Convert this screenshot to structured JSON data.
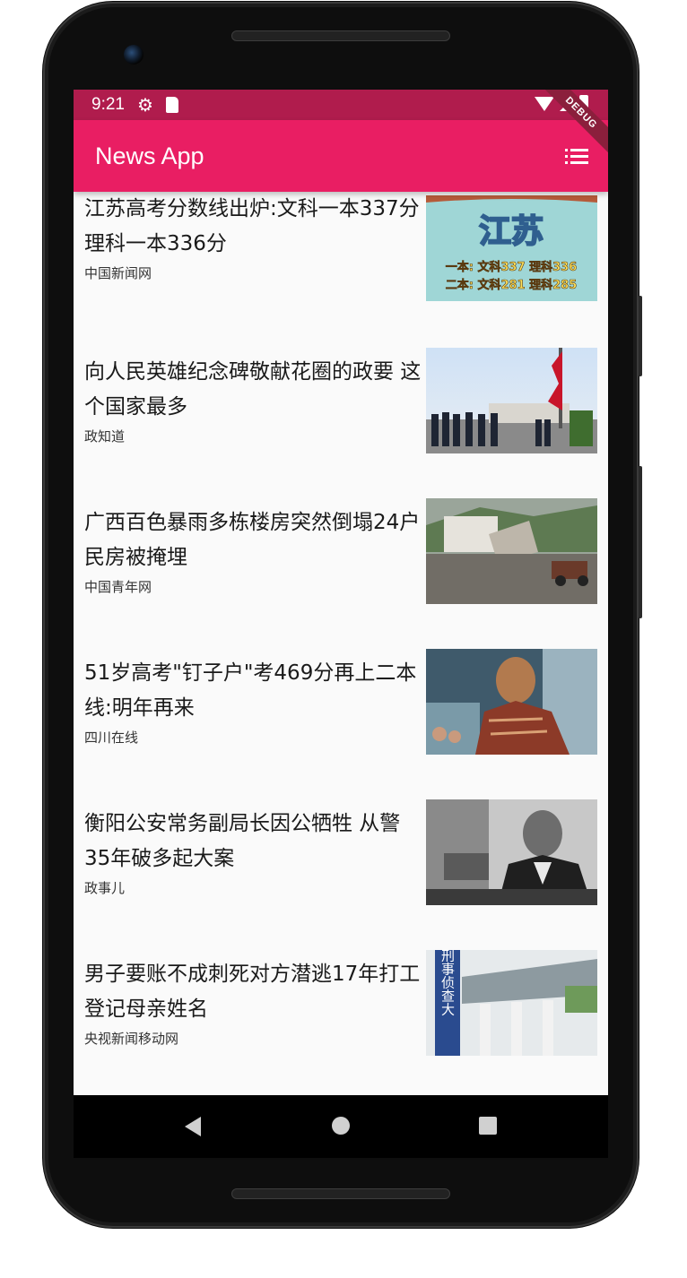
{
  "status_bar": {
    "time": "9:21",
    "icons": [
      "gear-icon",
      "sd-card-icon",
      "wifi-icon",
      "signal-icon",
      "battery-icon"
    ]
  },
  "debug_banner": "DEBUG",
  "app_bar": {
    "title": "News App",
    "menu_icon": "list-icon"
  },
  "news": [
    {
      "title": "江苏高考分数线出炉:文科一本337分 理科一本336分",
      "source": "中国新闻网",
      "thumb": {
        "heading": "江苏",
        "line1": "一本: 文科337  理科336",
        "line2": "二本: 文科281  理科285"
      }
    },
    {
      "title": "向人民英雄纪念碑敬献花圈的政要 这个国家最多",
      "source": "政知道"
    },
    {
      "title": "广西百色暴雨多栋楼房突然倒塌24户民房被掩埋",
      "source": "中国青年网"
    },
    {
      "title": "51岁高考\"钉子户\"考469分再上二本线:明年再来",
      "source": "四川在线"
    },
    {
      "title": "衡阳公安常务副局长因公牺牲 从警35年破多起大案",
      "source": "政事儿"
    },
    {
      "title": "男子要账不成刺死对方潜逃17年打工登记母亲姓名",
      "source": "央视新闻移动网",
      "thumb": {
        "sign": "刑事侦查大"
      }
    }
  ],
  "colors": {
    "app_bar": "#e91e63",
    "status_bar": "#b01c4d",
    "background": "#fafafa"
  }
}
